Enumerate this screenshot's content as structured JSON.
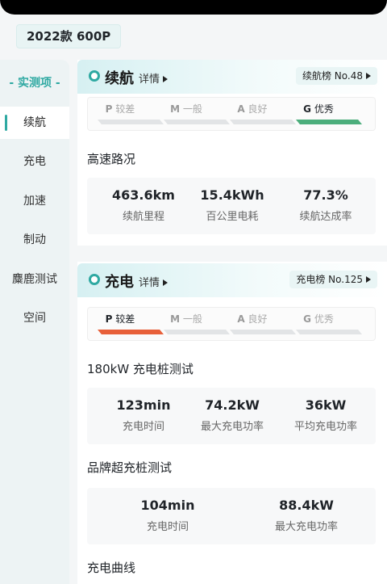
{
  "model": "2022款 600P",
  "sidebar": {
    "title": "- 实测项 -",
    "items": [
      {
        "label": "续航"
      },
      {
        "label": "充电"
      },
      {
        "label": "加速"
      },
      {
        "label": "制动"
      },
      {
        "label": "麋鹿测试"
      },
      {
        "label": "空间"
      }
    ]
  },
  "range": {
    "title": "续航",
    "detail": "详情",
    "rank": "续航榜 No.48",
    "grades": [
      {
        "letter": "P",
        "text": "较差"
      },
      {
        "letter": "M",
        "text": "一般"
      },
      {
        "letter": "A",
        "text": "良好"
      },
      {
        "letter": "G",
        "text": "优秀"
      }
    ],
    "active_grade": "G",
    "highway_title": "高速路况",
    "stats": [
      {
        "value": "463.6km",
        "label": "续航里程"
      },
      {
        "value": "15.4kWh",
        "label": "百公里电耗"
      },
      {
        "value": "77.3%",
        "label": "续航达成率"
      }
    ]
  },
  "charging": {
    "title": "充电",
    "detail": "详情",
    "rank": "充电榜 No.125",
    "grades": [
      {
        "letter": "P",
        "text": "较差"
      },
      {
        "letter": "M",
        "text": "一般"
      },
      {
        "letter": "A",
        "text": "良好"
      },
      {
        "letter": "G",
        "text": "优秀"
      }
    ],
    "active_grade": "P",
    "test1_title": "180kW 充电桩测试",
    "test1_stats": [
      {
        "value": "123min",
        "label": "充电时间"
      },
      {
        "value": "74.2kW",
        "label": "最大充电功率"
      },
      {
        "value": "36kW",
        "label": "平均充电功率"
      }
    ],
    "test2_title": "品牌超充桩测试",
    "test2_stats": [
      {
        "value": "104min",
        "label": "充电时间"
      },
      {
        "value": "88.4kW",
        "label": "最大充电功率"
      }
    ],
    "curve_title": "充电曲线"
  },
  "colors": {
    "accent": "#2fa9a2",
    "grade_good": "#4cae7c",
    "grade_poor": "#e8603a"
  }
}
